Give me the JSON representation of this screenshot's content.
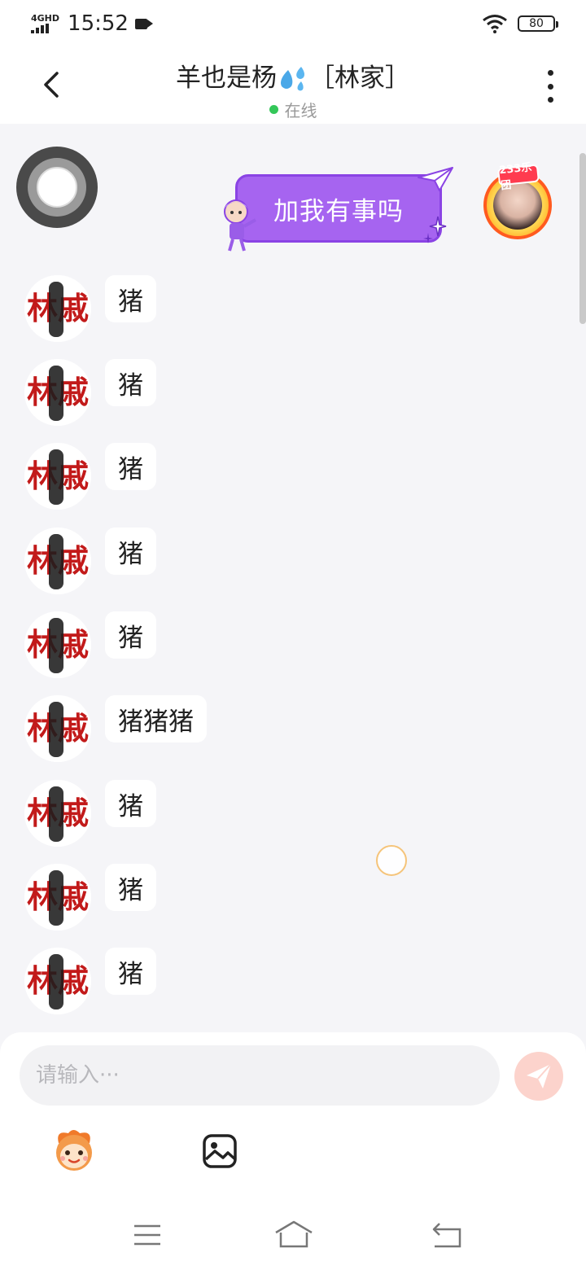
{
  "status_bar": {
    "network": "4GHD",
    "time": "15:52",
    "battery": "80"
  },
  "header": {
    "title_name": "羊也是杨",
    "title_group": "［林家］",
    "status": "在线"
  },
  "chat": {
    "sent_message": {
      "text": "加我有事吗",
      "avatar_badge": "233乐团"
    },
    "received_messages": [
      {
        "text": "猪"
      },
      {
        "text": "猪"
      },
      {
        "text": "猪"
      },
      {
        "text": "猪"
      },
      {
        "text": "猪"
      },
      {
        "text": "猪猪猪"
      },
      {
        "text": "猪"
      },
      {
        "text": "猪"
      },
      {
        "text": "猪"
      }
    ]
  },
  "composer": {
    "placeholder": "请输入···"
  },
  "colors": {
    "accent_purple": "#a664f0",
    "online_green": "#34c759",
    "send_button": "#fcd3cc"
  },
  "icons": [
    "back-icon",
    "more-icon",
    "float-ball-icon",
    "paper-plane-icon",
    "send-icon",
    "emoji-icon",
    "image-icon",
    "menu-icon",
    "home-icon",
    "return-icon"
  ]
}
